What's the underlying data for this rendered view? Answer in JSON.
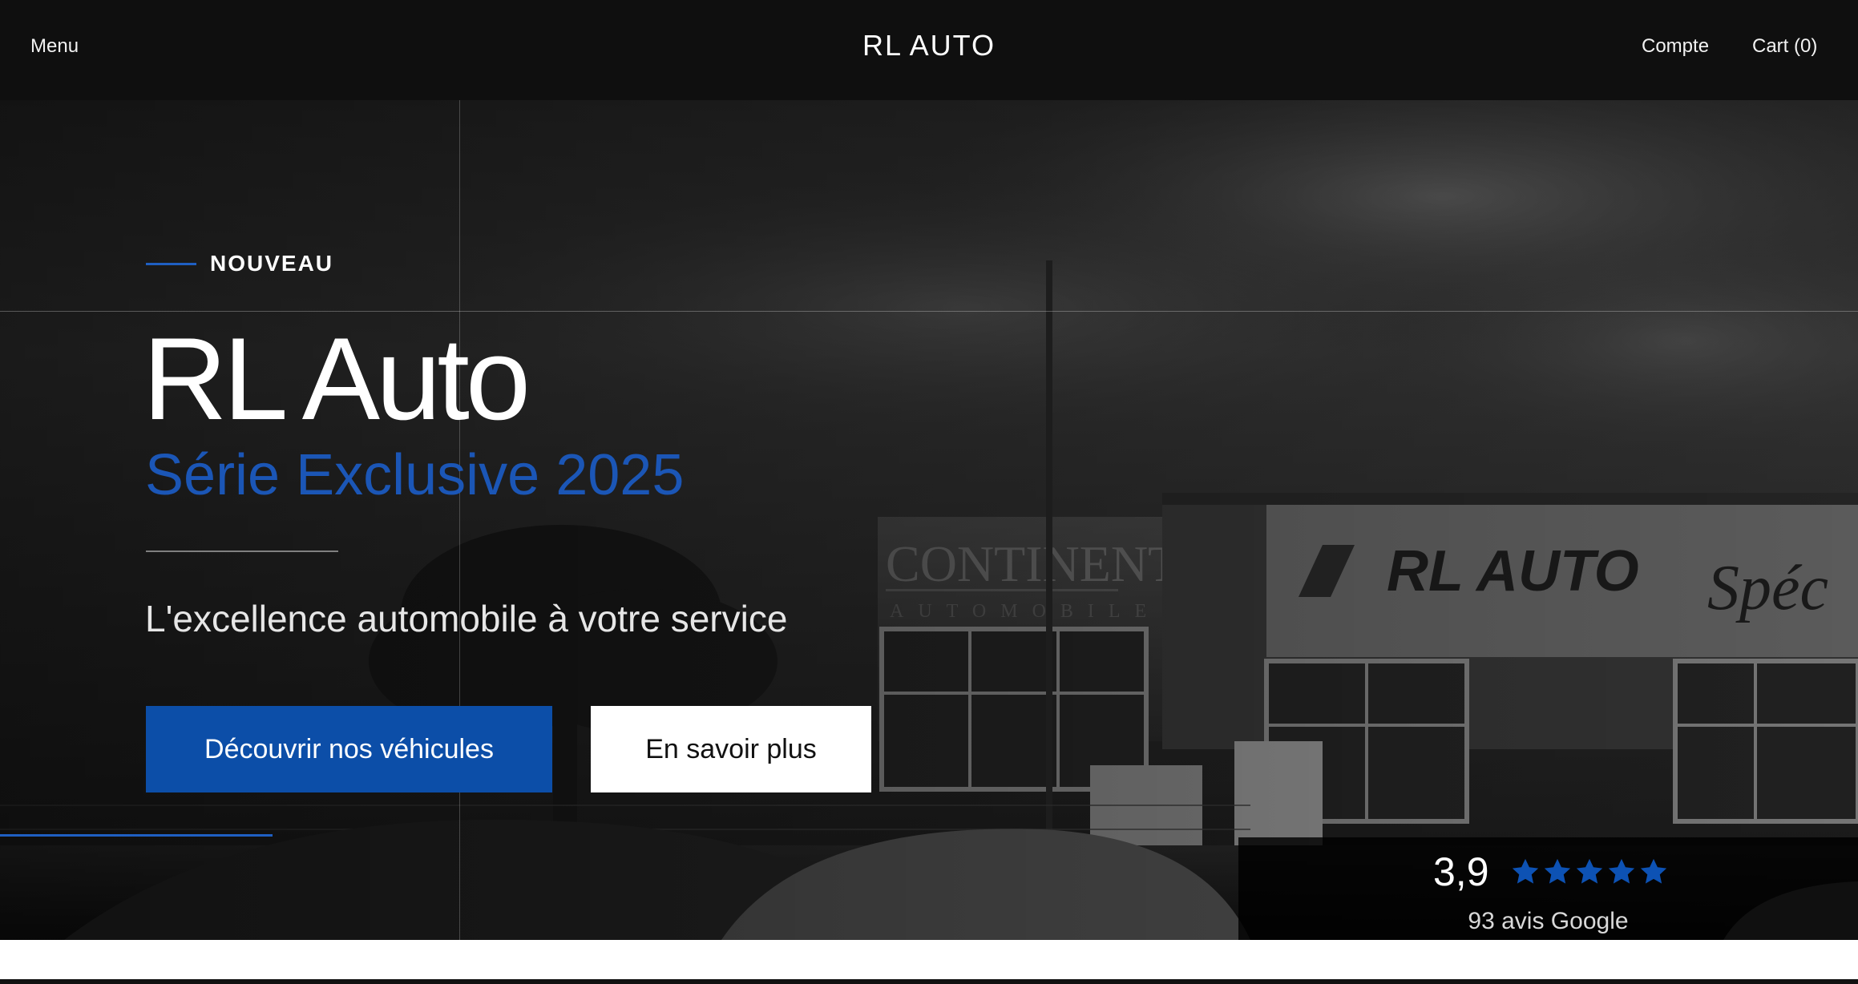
{
  "header": {
    "menu_label": "Menu",
    "brand": "RL AUTO",
    "account_label": "Compte",
    "cart_label": "Cart (0)"
  },
  "hero": {
    "eyebrow": "NOUVEAU",
    "title": "RL Auto",
    "subtitle": "Série Exclusive 2025",
    "tagline": "L'excellence automobile à votre service",
    "primary_button": "Découvrir nos véhicules",
    "secondary_button": "En savoir plus",
    "background_image": {
      "storefront_sign": "RL AUTO",
      "neighbor_sign": "CONTINENTAL",
      "neighbor_sign_sub": "AUTOMOBILE"
    }
  },
  "rating": {
    "score": "3,9",
    "stars_total": 5,
    "count_label": "93 avis Google"
  },
  "colors": {
    "accent_blue": "#0c4ea8",
    "subtitle_blue": "#1b56b6",
    "header_bg": "#0f0f0f"
  }
}
